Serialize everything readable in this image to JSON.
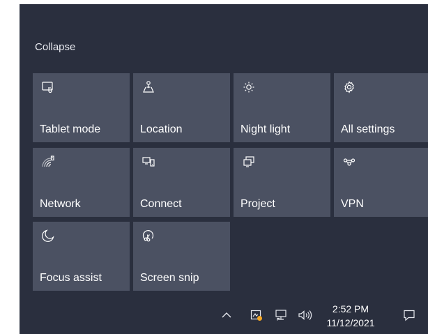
{
  "action_center": {
    "collapse_label": "Collapse",
    "tiles": [
      {
        "label": "Tablet mode",
        "icon": "tablet-mode-icon"
      },
      {
        "label": "Location",
        "icon": "location-icon"
      },
      {
        "label": "Night light",
        "icon": "night-light-icon"
      },
      {
        "label": "All settings",
        "icon": "gear-icon"
      },
      {
        "label": "Network",
        "icon": "network-icon"
      },
      {
        "label": "Connect",
        "icon": "connect-icon"
      },
      {
        "label": "Project",
        "icon": "project-icon"
      },
      {
        "label": "VPN",
        "icon": "vpn-icon"
      },
      {
        "label": "Focus assist",
        "icon": "moon-icon"
      },
      {
        "label": "Screen snip",
        "icon": "screen-snip-icon"
      }
    ]
  },
  "taskbar": {
    "time": "2:52 PM",
    "date": "11/12/2021",
    "icons": [
      "chevron-up-icon",
      "notification-app-icon",
      "network-monitor-icon",
      "speaker-icon",
      "action-center-icon"
    ]
  },
  "colors": {
    "panel_bg": "#2a2f3e",
    "tile_bg": "#4b5162",
    "badge": "#f5a623"
  }
}
